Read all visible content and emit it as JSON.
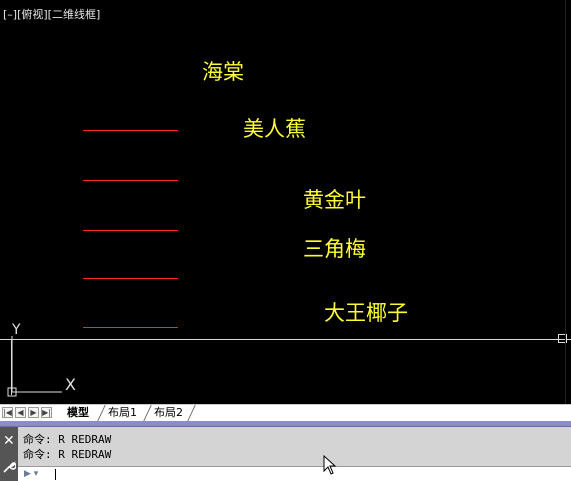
{
  "viewport": {
    "label": "[–][俯视][二维线框]",
    "plants": [
      "海棠",
      "美人蕉",
      "黄金叶",
      "三角梅",
      "大王椰子"
    ],
    "ucs_axis_y": "Y",
    "ucs_axis_x": "X",
    "line_color": "#ff2a2a",
    "text_color": "#ffff33"
  },
  "tabs": {
    "items": [
      "模型",
      "布局1",
      "布局2"
    ],
    "active": "模型"
  },
  "command": {
    "history": [
      "命令: R REDRAW",
      "命令: R REDRAW"
    ],
    "input_value": ""
  }
}
